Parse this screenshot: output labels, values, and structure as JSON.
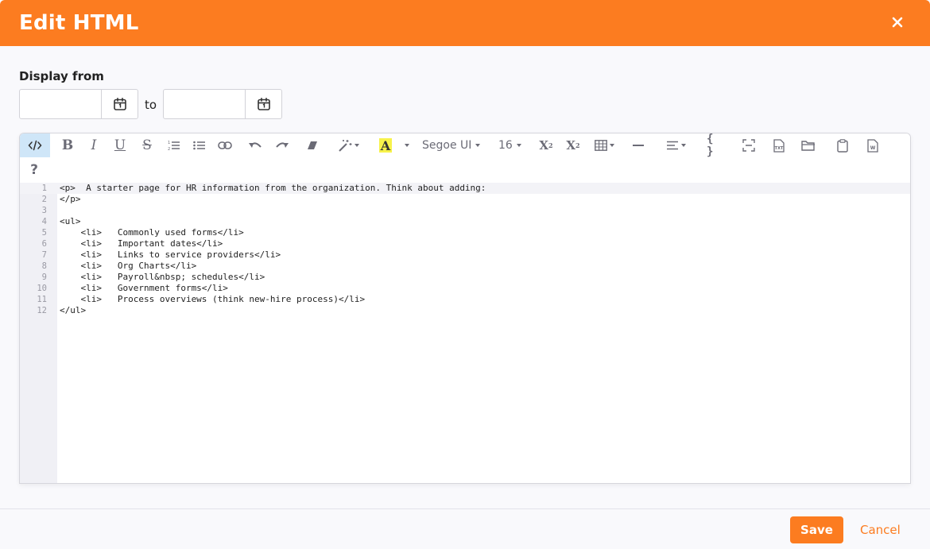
{
  "dialog": {
    "title": "Edit HTML",
    "close_icon": "close-icon",
    "accent_color": "#fc7c20"
  },
  "display": {
    "label": "Display from",
    "from_value": "",
    "to_label": "to",
    "to_value": ""
  },
  "toolbar": {
    "font_family": "Segoe UI",
    "font_size": "16",
    "help_label": "?",
    "icons": [
      "code-view-icon",
      "bold-icon",
      "italic-icon",
      "underline-icon",
      "strikethrough-icon",
      "ordered-list-icon",
      "unordered-list-icon",
      "link-icon",
      "undo-icon",
      "redo-icon",
      "eraser-icon",
      "magic-wand-icon",
      "font-color-icon",
      "superscript-icon",
      "subscript-icon",
      "table-icon",
      "horizontal-rule-icon",
      "align-icon",
      "code-block-icon",
      "select-all-icon",
      "import-txt-icon",
      "open-folder-icon",
      "paste-icon",
      "import-word-icon",
      "help-icon"
    ]
  },
  "code": {
    "current_line": 1,
    "lines": [
      "<p>  A starter page for HR information from the organization. Think about adding:",
      "</p>",
      "",
      "<ul>",
      "    <li>   Commonly used forms</li>",
      "    <li>   Important dates</li>",
      "    <li>   Links to service providers</li>",
      "    <li>   Org Charts</li>",
      "    <li>   Payroll&nbsp; schedules</li>",
      "    <li>   Government forms</li>",
      "    <li>   Process overviews (think new-hire process)</li>",
      "</ul>"
    ]
  },
  "footer": {
    "save_label": "Save",
    "cancel_label": "Cancel"
  }
}
